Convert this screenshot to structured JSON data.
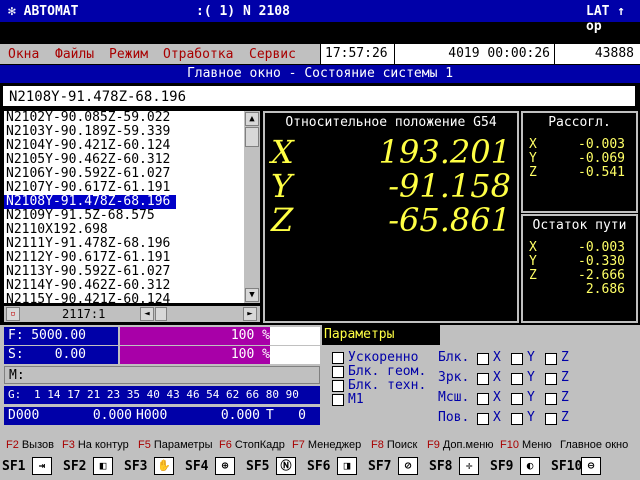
{
  "titlebar": {
    "app": "✻ АВТОМАТ",
    "status_mid": ":(   1) N   2108",
    "lang": "LAT ↑ ор"
  },
  "menu": {
    "items": [
      "Окна",
      "Файлы",
      "Режим",
      "Отработка",
      "Сервис"
    ],
    "time": "17:57:26",
    "counter": "4019 00:00:26",
    "code": "43888"
  },
  "main_header": "Главное окно - Состояние системы 1",
  "command_line": "N2108Y-91.478Z-68.196",
  "program": {
    "lines": [
      "N2102Y-90.085Z-59.022",
      "N2103Y-90.189Z-59.339",
      "N2104Y-90.421Z-60.124",
      "N2105Y-90.462Z-60.312",
      "N2106Y-90.592Z-61.027",
      "N2107Y-90.617Z-61.191",
      "N2108Y-91.478Z-68.196",
      "N2109Y-91.5Z-68.575",
      "N2110X192.698",
      "N2111Y-91.478Z-68.196",
      "N2112Y-90.617Z-61.191",
      "N2113Y-90.592Z-61.027",
      "N2114Y-90.462Z-60.312",
      "N2115Y-90.421Z-60.124"
    ],
    "selected_index": 6,
    "position_indicator": "2117:1"
  },
  "position": {
    "title": "Относительное положение G54",
    "axes": [
      {
        "axis": "X",
        "value": "193.201"
      },
      {
        "axis": "Y",
        "value": "-91.158"
      },
      {
        "axis": "Z",
        "value": "-65.861"
      }
    ]
  },
  "mismatch": {
    "title": "Рассогл.",
    "values": [
      {
        "axis": "X",
        "value": "-0.003"
      },
      {
        "axis": "Y",
        "value": "-0.069"
      },
      {
        "axis": "Z",
        "value": "-0.541"
      }
    ]
  },
  "remaining": {
    "title": "Остаток пути",
    "values": [
      {
        "axis": "X",
        "value": "-0.003"
      },
      {
        "axis": "Y",
        "value": "-0.330"
      },
      {
        "axis": "Z",
        "value": "-2.666"
      }
    ],
    "total": "2.686"
  },
  "feed": {
    "label": "F:",
    "value": "5000.00",
    "percent_text": "100 %",
    "percent": 100
  },
  "spindle": {
    "label": "S:",
    "value": "0.00",
    "percent_text": "100 %",
    "percent": 100
  },
  "m_label": "M:",
  "g": {
    "label": "G:",
    "codes": "1 14 17 21 23 35 40 43 46 54 62 66 80 90"
  },
  "bottom_fields": {
    "d": "D000",
    "d_val": "0.000",
    "h": "H000",
    "h_val": "0.000",
    "t": "T",
    "t_val": "0"
  },
  "params": {
    "title": "Параметры",
    "options": [
      "Ускоренно",
      "Блк. геом.",
      "Блк. техн.",
      "М1"
    ]
  },
  "locks": {
    "rows": [
      "Блк.",
      "Зрк.",
      "Мсш.",
      "Пов."
    ],
    "axes": [
      "X",
      "Y",
      "Z"
    ]
  },
  "fkeys": [
    {
      "key": "F2",
      "label": "Вызов"
    },
    {
      "key": "F3",
      "label": "На контур"
    },
    {
      "key": "F5",
      "label": "Параметры"
    },
    {
      "key": "F6",
      "label": "СтопКадр"
    },
    {
      "key": "F7",
      "label": "Менеджер"
    },
    {
      "key": "F8",
      "label": "Поиск"
    },
    {
      "key": "F9",
      "label": "Доп.меню"
    },
    {
      "key": "F10",
      "label": "Меню"
    },
    {
      "key": "",
      "label": "Главное окно"
    }
  ],
  "softkeys": [
    "SF1",
    "SF2",
    "SF3",
    "SF4",
    "SF5",
    "SF6",
    "SF7",
    "SF8",
    "SF9",
    "SF10"
  ],
  "colors": {
    "accent_blue": "#0000a8",
    "progress_magenta": "#a800a8",
    "axis_yellow": "#ffff44"
  }
}
